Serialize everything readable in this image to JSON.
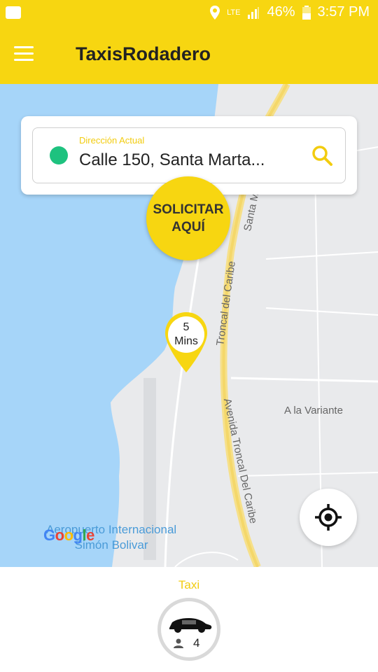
{
  "status_bar": {
    "network": "LTE",
    "battery": "46%",
    "time": "3:57 PM"
  },
  "header": {
    "title": "TaxisRodadero"
  },
  "address": {
    "label": "Dirección Actual",
    "value": "Calle 150, Santa Marta..."
  },
  "request_button": {
    "line1": "SOLICITAR",
    "line2": "AQUÍ"
  },
  "eta": {
    "value": "5",
    "unit": "Mins"
  },
  "map_labels": {
    "santa_marta_road": "Santa Ma",
    "troncal_caribe": "Troncal del Caribe",
    "avenida_troncal": "Avenida Troncal Del Caribe",
    "la_variante": "A la Variante",
    "airport_line1": "Aeropuerto Internacional",
    "airport_line2": "Simón Bolivar",
    "google": "Google"
  },
  "vehicle": {
    "label": "Taxi",
    "seats": "4"
  },
  "colors": {
    "brand_yellow": "#f7d611",
    "location_green": "#1ec27f",
    "water": "#a6d5f9"
  }
}
